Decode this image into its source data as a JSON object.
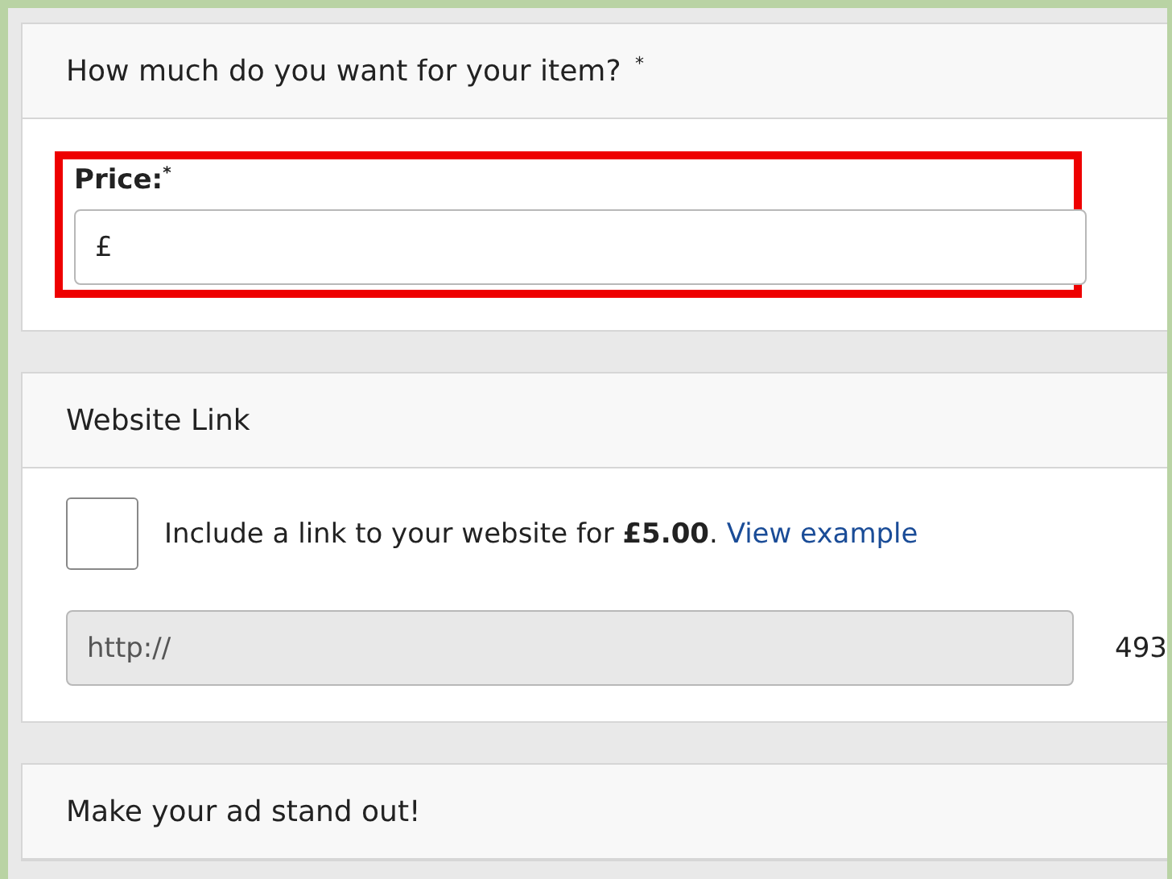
{
  "sections": [
    {
      "kind": "price",
      "title": "How much do you want for your item? $^{*}$",
      "price": {
        "label": "Price:$^{*}$",
        "value": "£",
        "highlighted": true
      }
    },
    {
      "kind": "link",
      "title": "Website Link",
      "option": {
        "checked": false,
        "text": "Include a link to your website for **£5.00**.",
        "link": "View example"
      },
      "url": {
        "value": "http://",
        "disabled": true
      },
      "counter": "493"
    },
    {
      "kind": "header",
      "title": "Make your ad stand out!"
    }
  ]
}
